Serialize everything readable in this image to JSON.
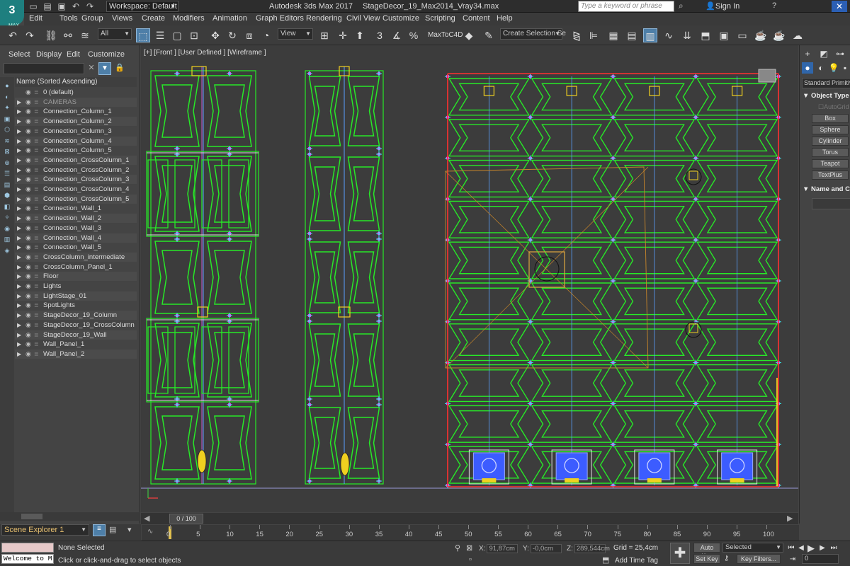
{
  "window": {
    "workspace_label": "Workspace: Default",
    "app_name": "Autodesk 3ds Max 2017",
    "file_name": "StageDecor_19_Max2014_Vray34.max",
    "search_placeholder": "Type a keyword or phrase",
    "sign_in": "Sign In",
    "close": "✕"
  },
  "logo": {
    "main": "3",
    "sub": "MAX"
  },
  "menu": [
    "Edit",
    "Tools",
    "Group",
    "Views",
    "Create",
    "Modifiers",
    "Animation",
    "Graph Editors",
    "Rendering",
    "Civil View",
    "Customize",
    "Scripting",
    "Content",
    "Help"
  ],
  "toolbar": {
    "filter_value": "All",
    "view_value": "View",
    "maxtoc4d": "MaxToC4D",
    "selection_set": "Create Selection Se"
  },
  "explorer": {
    "menu": [
      "Select",
      "Display",
      "Edit",
      "Customize"
    ],
    "header": "Name (Sorted Ascending)",
    "rows": [
      {
        "name": "0 (default)",
        "gray": false
      },
      {
        "name": "CAMERAS",
        "gray": true
      },
      {
        "name": "Connection_Column_1",
        "gray": false
      },
      {
        "name": "Connection_Column_2",
        "gray": false
      },
      {
        "name": "Connection_Column_3",
        "gray": false
      },
      {
        "name": "Connection_Column_4",
        "gray": false
      },
      {
        "name": "Connection_Column_5",
        "gray": false
      },
      {
        "name": "Connection_CrossColumn_1",
        "gray": false
      },
      {
        "name": "Connection_CrossColumn_2",
        "gray": false
      },
      {
        "name": "Connection_CrossColumn_3",
        "gray": false
      },
      {
        "name": "Connection_CrossColumn_4",
        "gray": false
      },
      {
        "name": "Connection_CrossColumn_5",
        "gray": false
      },
      {
        "name": "Connection_Wall_1",
        "gray": false
      },
      {
        "name": "Connection_Wall_2",
        "gray": false
      },
      {
        "name": "Connection_Wall_3",
        "gray": false
      },
      {
        "name": "Connection_Wall_4",
        "gray": false
      },
      {
        "name": "Connection_Wall_5",
        "gray": false
      },
      {
        "name": "CrossColumn_intermediate",
        "gray": false
      },
      {
        "name": "CrossColumn_Panel_1",
        "gray": false
      },
      {
        "name": "Floor",
        "gray": false
      },
      {
        "name": "Lights",
        "gray": false
      },
      {
        "name": "LightStage_01",
        "gray": false
      },
      {
        "name": "SpotLights",
        "gray": false
      },
      {
        "name": "StageDecor_19_Column",
        "gray": false
      },
      {
        "name": "StageDecor_19_CrossColumn",
        "gray": false
      },
      {
        "name": "StageDecor_19_Wall",
        "gray": false
      },
      {
        "name": "Wall_Panel_1",
        "gray": false
      },
      {
        "name": "Wall_Panel_2",
        "gray": false
      }
    ],
    "scene_explorer": "Scene Explorer 1"
  },
  "viewport": {
    "label": "[+] [Front ] [User Defined ] [Wireframe ]",
    "colors": {
      "wire": "#27e827",
      "accent": "#ff3dff",
      "cyan": "#2ee8e8",
      "blue": "#3c5cff",
      "yellow": "#f0d020"
    }
  },
  "command_panel": {
    "dropdown": "Standard Primitives",
    "section_object_type": "Object Type",
    "autogrid": "AutoGrid",
    "buttons": [
      "Box",
      "Sphere",
      "Cylinder",
      "Torus",
      "Teapot",
      "TextPlus"
    ],
    "section_name_color": "Name and Color"
  },
  "timeline": {
    "slider": "0 / 100",
    "ticks": [
      "0",
      "5",
      "10",
      "15",
      "20",
      "25",
      "30",
      "35",
      "40",
      "45",
      "50",
      "55",
      "60",
      "65",
      "70",
      "75",
      "80",
      "85",
      "90",
      "95",
      "100"
    ]
  },
  "status": {
    "none_selected": "None Selected",
    "prompt": "Click or click-and-drag to select objects",
    "listener": "Welcome to M",
    "x_label": "X:",
    "x_value": "91,87cm",
    "y_label": "Y:",
    "y_value": "-0,0cm",
    "z_label": "Z:",
    "z_value": "289,544cm",
    "grid": "Grid = 25,4cm",
    "add_time_tag": "Add Time Tag",
    "auto_key": "Auto Key",
    "set_key": "Set Key",
    "selected": "Selected",
    "key_filters": "Key Filters...",
    "frame": "0"
  }
}
